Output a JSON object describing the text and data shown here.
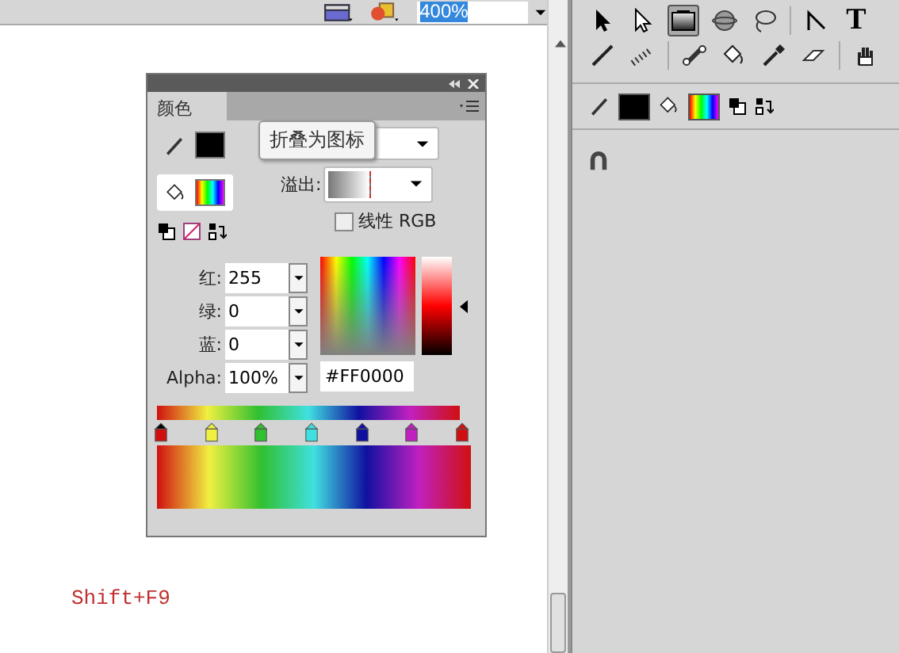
{
  "toolbar": {
    "zoom": "400%"
  },
  "color_panel": {
    "tab": {
      "label": "颜色",
      "selected": true
    },
    "tooltip": "折叠为图标",
    "overflow_label": "溢出:",
    "linear_rgb": {
      "label": "线性 RGB",
      "checked": false
    },
    "stroke_selected": false,
    "fill_selected": true,
    "channels": [
      {
        "label": "红:",
        "value": "255"
      },
      {
        "label": "绿:",
        "value": "0"
      },
      {
        "label": "蓝:",
        "value": "0"
      },
      {
        "label": "Alpha:",
        "value": "100%"
      }
    ],
    "hex": "#FF0000",
    "brightness": {
      "level": 0.5
    },
    "gradient_stops": [
      {
        "color": "#d01010",
        "selected": true
      },
      {
        "color": "#f0f040",
        "selected": false
      },
      {
        "color": "#30c030",
        "selected": false
      },
      {
        "color": "#40e0e0",
        "selected": false
      },
      {
        "color": "#1010a0",
        "selected": false
      },
      {
        "color": "#c020c0",
        "selected": false
      },
      {
        "color": "#d01010",
        "selected": false
      }
    ]
  },
  "tools_panel": {
    "rows": [
      [
        [
          {
            "kind": "arrow",
            "selected": false
          },
          {
            "kind": "subselect",
            "selected": false
          },
          {
            "kind": "gradient",
            "selected": true
          },
          {
            "kind": "sphere",
            "selected": false
          },
          {
            "kind": "lasso",
            "selected": false
          }
        ],
        [
          {
            "kind": "pen",
            "selected": false
          },
          {
            "kind": "text",
            "label": "T",
            "selected": false
          }
        ]
      ],
      [
        [
          {
            "kind": "brush",
            "selected": false
          },
          {
            "kind": "deco",
            "selected": false
          }
        ],
        [
          {
            "kind": "bone",
            "selected": false
          },
          {
            "kind": "bucket",
            "selected": false
          },
          {
            "kind": "eyedropper",
            "selected": false
          },
          {
            "kind": "eraser",
            "selected": false
          }
        ],
        [
          {
            "kind": "hand",
            "selected": false
          }
        ]
      ]
    ]
  },
  "shortcut": "Shift+F9"
}
